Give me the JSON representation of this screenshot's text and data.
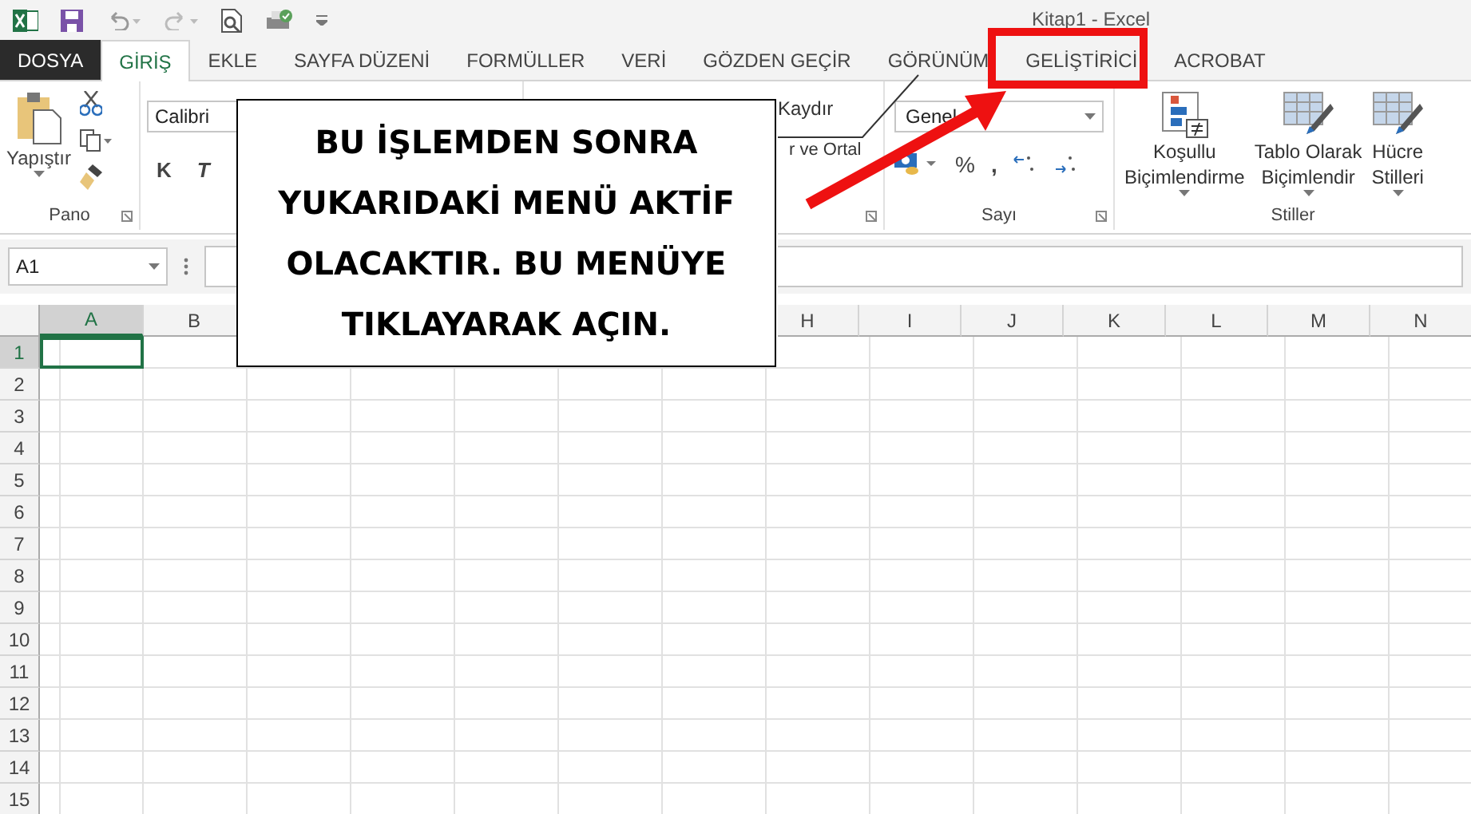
{
  "window": {
    "title": "Kitap1 - Excel"
  },
  "tabs": [
    {
      "label": "DOSYA",
      "kind": "file",
      "selected": false
    },
    {
      "label": "GİRİŞ",
      "kind": "tab",
      "selected": true
    },
    {
      "label": "EKLE",
      "kind": "tab",
      "selected": false
    },
    {
      "label": "SAYFA DÜZENİ",
      "kind": "tab",
      "selected": false
    },
    {
      "label": "FORMÜLLER",
      "kind": "tab",
      "selected": false
    },
    {
      "label": "VERİ",
      "kind": "tab",
      "selected": false
    },
    {
      "label": "GÖZDEN GEÇİR",
      "kind": "tab",
      "selected": false
    },
    {
      "label": "GÖRÜNÜM",
      "kind": "tab",
      "selected": false
    },
    {
      "label": "GELİŞTİRİCİ",
      "kind": "tab",
      "selected": false
    },
    {
      "label": "ACROBAT",
      "kind": "tab",
      "selected": false
    }
  ],
  "ribbon": {
    "clipboard": {
      "paste": "Yapıştır",
      "label": "Pano"
    },
    "font": {
      "font_name": "Calibri",
      "bold": "K",
      "italic": "T"
    },
    "alignment": {
      "wrap": "Kaydır",
      "merge": "r ve Ortal"
    },
    "number": {
      "format": "Genel",
      "percent": "%",
      "comma": ",",
      "label": "Sayı"
    },
    "styles": {
      "buttons": [
        "Koşullu\nBiçimlendirme",
        "Tablo Olarak\nBiçimlendir",
        "Hücre\nStilleri"
      ],
      "label": "Stiller"
    }
  },
  "formula_bar": {
    "name_box": "A1"
  },
  "sheet": {
    "columns": [
      {
        "kind": "header",
        "label": "A",
        "selected": true
      },
      {
        "kind": "header",
        "label": "B",
        "selected": false
      },
      {
        "kind": "covered"
      },
      {
        "kind": "covered"
      },
      {
        "kind": "covered"
      },
      {
        "kind": "covered"
      },
      {
        "kind": "covered"
      },
      {
        "kind": "header",
        "label": "H",
        "selected": false
      },
      {
        "kind": "header",
        "label": "I",
        "selected": false
      },
      {
        "kind": "header",
        "label": "J",
        "selected": false
      },
      {
        "kind": "header",
        "label": "K",
        "selected": false
      },
      {
        "kind": "header",
        "label": "L",
        "selected": false
      },
      {
        "kind": "header",
        "label": "M",
        "selected": false
      },
      {
        "kind": "header",
        "label": "N",
        "selected": false
      }
    ],
    "rows": [
      {
        "label": "1",
        "selected": true
      },
      {
        "label": "2",
        "selected": false
      },
      {
        "label": "3",
        "selected": false
      },
      {
        "label": "4",
        "selected": false
      },
      {
        "label": "5",
        "selected": false
      },
      {
        "label": "6",
        "selected": false
      },
      {
        "label": "7",
        "selected": false
      },
      {
        "label": "8",
        "selected": false
      },
      {
        "label": "9",
        "selected": false
      },
      {
        "label": "10",
        "selected": false
      },
      {
        "label": "11",
        "selected": false
      },
      {
        "label": "12",
        "selected": false
      },
      {
        "label": "13",
        "selected": false
      },
      {
        "label": "14",
        "selected": false
      },
      {
        "label": "15",
        "selected": false
      }
    ]
  },
  "callout": {
    "text": "BU İŞLEMDEN SONRA\nYUKARIDAKİ MENÜ AKTİF\nOLACAKTIR. BU MENÜYE\nTIKLAYARAK AÇIN."
  }
}
